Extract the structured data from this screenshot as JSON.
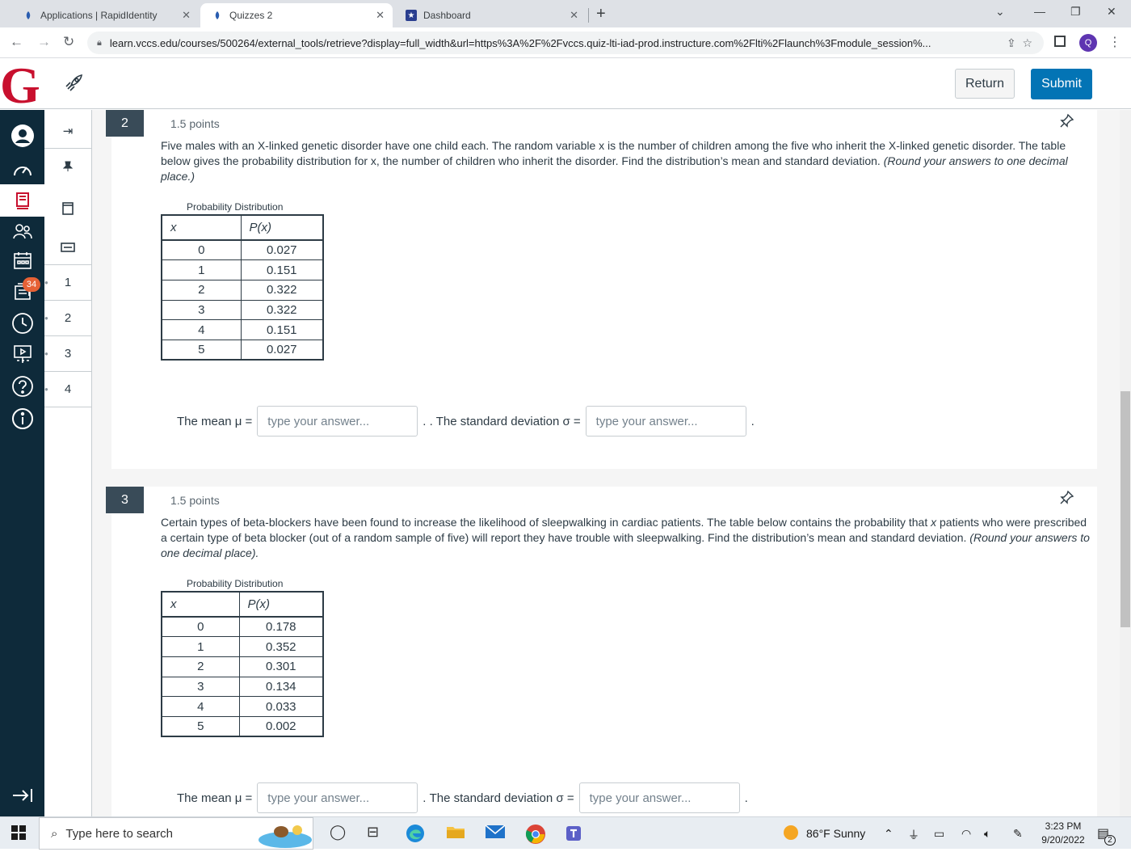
{
  "browser": {
    "tabs": [
      {
        "label": "Applications | RapidIdentity",
        "icon": "rapididentity-icon"
      },
      {
        "label": "Quizzes 2",
        "icon": "rapididentity-icon"
      },
      {
        "label": "Dashboard",
        "icon": "star-icon"
      }
    ],
    "url": "learn.vccs.edu/courses/500264/external_tools/retrieve?display=full_width&url=https%3A%2F%2Fvccs.quiz-lti-iad-prod.instructure.com%2Flti%2Flaunch%3Fmodule_session%...",
    "profile_initial": "Q"
  },
  "header": {
    "logo": "G",
    "return_label": "Return",
    "submit_label": "Submit",
    "brand_color": "#c8102e",
    "accent_color": "#0374b5"
  },
  "global_nav": {
    "badge": "34"
  },
  "question_nav": {
    "items": [
      "1",
      "2",
      "3",
      "4"
    ]
  },
  "questions": [
    {
      "number": "2",
      "points": "1.5 points",
      "text": "Five males with an X-linked genetic disorder have one child each. The random variable x is the number of children among the five who inherit the X-linked genetic disorder. The table below gives the probability distribution for x, the number of children who inherit the disorder. Find the distribution’s mean and standard deviation.",
      "instruction": "(Round your answers to one decimal place.)",
      "table_caption": "Probability Distribution",
      "table_headers": [
        "x",
        "P(x)"
      ],
      "table_rows": [
        [
          "0",
          "0.027"
        ],
        [
          "1",
          "0.151"
        ],
        [
          "2",
          "0.322"
        ],
        [
          "3",
          "0.322"
        ],
        [
          "4",
          "0.151"
        ],
        [
          "5",
          "0.027"
        ]
      ],
      "mean_label": "The mean μ =",
      "mean_placeholder": "type your answer...",
      "sd_label": ". The standard deviation σ =",
      "sd_placeholder": "type your answer...",
      "sep1": ".",
      "sep2": "."
    },
    {
      "number": "3",
      "points": "1.5 points",
      "text_a": "Certain types of beta-blockers have been found to increase the likelihood of sleepwalking in cardiac patients. The table below contains the probability that ",
      "text_x": "x",
      "text_b": " patients who were prescribed a certain type of beta blocker (out of a random sample of five) will report they have trouble with sleepwalking. Find the distribution’s mean and standard deviation.",
      "instruction": "(Round your answers to one decimal place).",
      "table_caption": "Probability Distribution",
      "table_headers": [
        "x",
        "P(x)"
      ],
      "table_rows": [
        [
          "0",
          "0.178"
        ],
        [
          "1",
          "0.352"
        ],
        [
          "2",
          "0.301"
        ],
        [
          "3",
          "0.134"
        ],
        [
          "4",
          "0.033"
        ],
        [
          "5",
          "0.002"
        ]
      ],
      "mean_label": "The mean μ =",
      "mean_placeholder": "type your answer...",
      "sd_label": "The standard deviation σ =",
      "sd_placeholder": "type your answer...",
      "sep1": ".",
      "sep2": "."
    }
  ],
  "taskbar": {
    "search_placeholder": "Type here to search",
    "weather": "86°F  Sunny",
    "time": "3:23 PM",
    "date": "9/20/2022",
    "notifications": "2"
  }
}
